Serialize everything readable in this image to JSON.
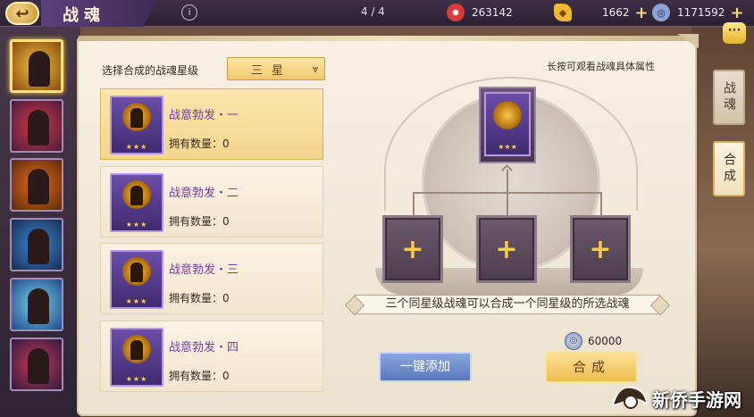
{
  "header": {
    "title": "战魂",
    "info_glyph": "i",
    "counter": "4 / 4",
    "currencies": [
      {
        "icon": "flame-coin-icon",
        "value": "263142",
        "color": "#d93a3a"
      },
      {
        "icon": "gold-ingot-icon",
        "value": "1662",
        "color": "#f2b632"
      },
      {
        "icon": "silver-coin-icon",
        "value": "1171592",
        "color": "#8fa2d6"
      }
    ]
  },
  "sidebar": {
    "thumbnails": [
      {
        "icon": "warrior-portrait-icon",
        "colors": [
          "#f3c13d",
          "#8a4b0f"
        ],
        "selected": true
      },
      {
        "icon": "red-warrior-portrait-icon",
        "colors": [
          "#d23a4a",
          "#4b1b3a"
        ],
        "selected": false
      },
      {
        "icon": "fire-warrior-portrait-icon",
        "colors": [
          "#e86a1a",
          "#5a2c0c"
        ],
        "selected": false
      },
      {
        "icon": "blue-warrior-portrait-icon",
        "colors": [
          "#3a8ad6",
          "#1a2c52"
        ],
        "selected": false
      },
      {
        "icon": "ice-warrior-portrait-icon",
        "colors": [
          "#7ad1f0",
          "#1f4a86"
        ],
        "selected": false
      },
      {
        "icon": "crimson-warrior-portrait-icon",
        "colors": [
          "#c83a5a",
          "#2e1a3e"
        ],
        "selected": false
      }
    ]
  },
  "left": {
    "select_label": "选择合成的战魂星级",
    "star_value": "三星",
    "star_chevron": "⩔",
    "items": [
      {
        "name": "战意勃发・一",
        "owned": "拥有数量：0",
        "stars": "★★★",
        "selected": true
      },
      {
        "name": "战意勃发・二",
        "owned": "拥有数量：0",
        "stars": "★★★",
        "selected": false
      },
      {
        "name": "战意勃发・三",
        "owned": "拥有数量：0",
        "stars": "★★★",
        "selected": false
      },
      {
        "name": "战意勃发・四",
        "owned": "拥有数量：0",
        "stars": "★★★",
        "selected": false
      }
    ]
  },
  "right": {
    "hint": "长按可观看战魂具体属性",
    "target_stars": "★★★",
    "slot_glyph": "+",
    "note": "三个同星级战魂可以合成一个同星级的所选战魂",
    "cost_value": "60000",
    "auto_add_label": "一键添加",
    "merge_label": "合成"
  },
  "tabs": [
    {
      "label": "战魂",
      "active": false
    },
    {
      "label": "合成",
      "active": true
    }
  ],
  "watermark": {
    "text": "新侨手游网"
  }
}
